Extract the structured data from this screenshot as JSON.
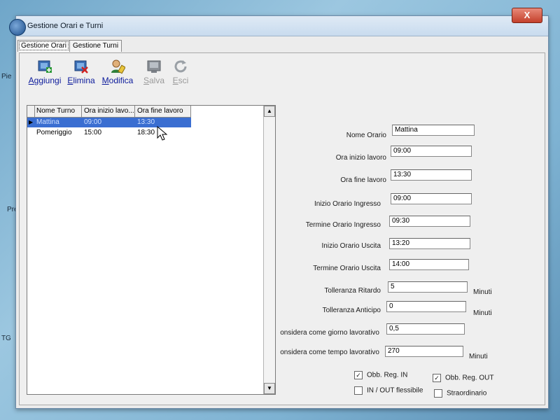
{
  "desktop": {
    "labels": [
      "Pie",
      "Pre",
      "T",
      "G"
    ]
  },
  "window": {
    "title": "Gestione Orari e Turni",
    "close_label": "X"
  },
  "tabs": [
    {
      "label": "Gestione Orari"
    },
    {
      "label": "Gestione Turni"
    }
  ],
  "toolbar": {
    "buttons": [
      {
        "label": "Aggiungi",
        "icon": "add-user-icon",
        "enabled": true
      },
      {
        "label": "Elimina",
        "icon": "delete-icon",
        "enabled": true
      },
      {
        "label": "Modifica",
        "icon": "edit-user-icon",
        "enabled": true
      },
      {
        "label": "Salva",
        "icon": "save-icon",
        "enabled": false
      },
      {
        "label": "Esci",
        "icon": "exit-icon",
        "enabled": false
      }
    ]
  },
  "grid": {
    "columns": [
      "Nome Turno",
      "Ora inizio lavo...",
      "Ora fine lavoro"
    ],
    "rows": [
      {
        "cells": [
          "Mattina",
          "09:00",
          "13:30"
        ],
        "selected": true
      },
      {
        "cells": [
          "Pomeriggio",
          "15:00",
          "18:30"
        ],
        "selected": false
      }
    ]
  },
  "form": {
    "fields": [
      {
        "label": "Nome Orario",
        "value": "Mattina"
      },
      {
        "label": "Ora inizio lavoro",
        "value": "09:00"
      },
      {
        "label": "Ora fine lavoro",
        "value": "13:30"
      },
      {
        "label": "Inizio Orario Ingresso",
        "value": "09:00"
      },
      {
        "label": "Termine Orario Ingresso",
        "value": "09:30"
      },
      {
        "label": "Inizio Orario Uscita",
        "value": "13:20"
      },
      {
        "label": "Termine Orario Uscita",
        "value": "14:00"
      },
      {
        "label": "Tolleranza Ritardo",
        "value": "5",
        "unit": "Minuti"
      },
      {
        "label": "Tolleranza Anticipo",
        "value": "0",
        "unit": "Minuti"
      },
      {
        "label": "onsidera come giorno lavorativo",
        "value": "0,5"
      },
      {
        "label": "onsidera come tempo lavorativo",
        "value": "270",
        "unit": "Minuti"
      }
    ],
    "checkboxes": [
      {
        "label": "Obb. Reg. IN",
        "checked": true
      },
      {
        "label": "Obb. Reg. OUT",
        "checked": true
      },
      {
        "label": "IN / OUT flessibile",
        "checked": false
      },
      {
        "label": "Straordinario",
        "checked": false
      }
    ]
  }
}
